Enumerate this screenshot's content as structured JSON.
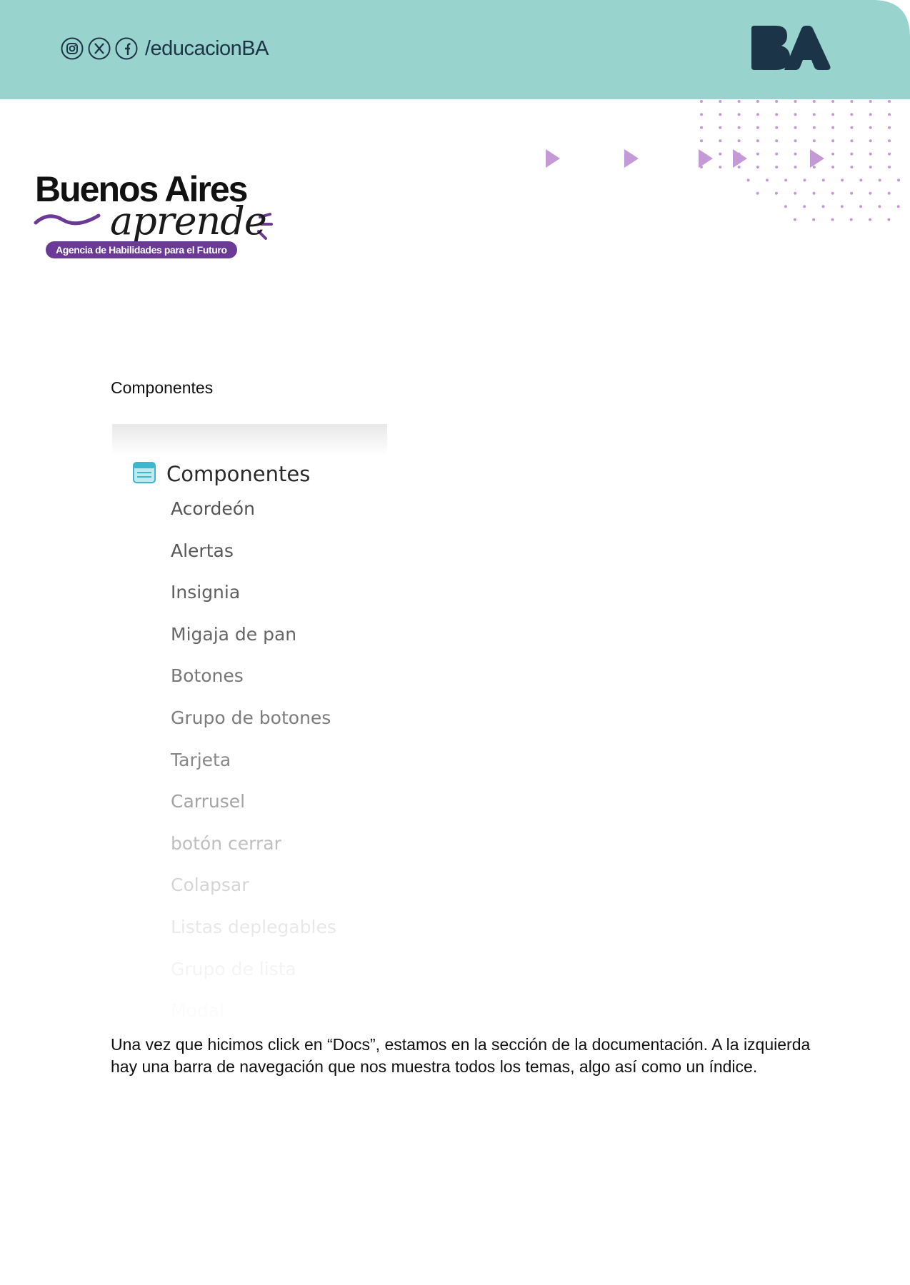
{
  "header": {
    "social_handle": "/educacionBA",
    "social_icons": [
      "instagram-icon",
      "x-icon",
      "facebook-icon"
    ],
    "ba_logo_text": "BA",
    "band_color": "#98d3cd",
    "logo_color": "#1b3447"
  },
  "brand": {
    "line1": "Buenos Aires",
    "line2": "aprende",
    "tagline": "Agencia de Habilidades para el Futuro",
    "accent": "#6a3a96"
  },
  "decoration": {
    "triangle_color": "#c49ad6",
    "dot_color": "#c49ad6"
  },
  "section_label": "Componentes",
  "nav": {
    "heading": "Componentes",
    "heading_icon": "list-icon",
    "items": [
      "Acordeón",
      "Alertas",
      "Insignia",
      "Migaja de pan",
      "Botones",
      "Grupo de botones",
      "Tarjeta",
      "Carrusel",
      "botón cerrar",
      "Colapsar",
      "Listas deplegables",
      "Grupo de lista",
      "Modal"
    ]
  },
  "paragraph": "Una vez que hicimos click en “Docs”, estamos en la sección de la documentación. A la izquierda  hay una barra de navegación que nos muestra todos los temas, algo así como un índice."
}
